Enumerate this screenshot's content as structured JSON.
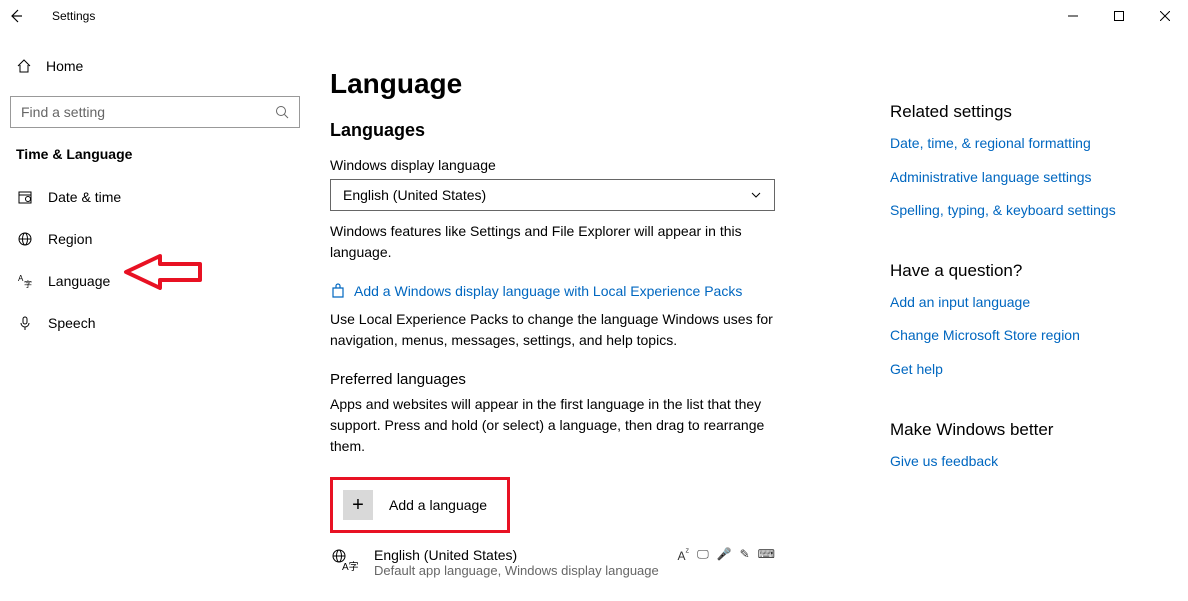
{
  "titlebar": {
    "app_title": "Settings"
  },
  "sidebar": {
    "home": "Home",
    "search_placeholder": "Find a setting",
    "category": "Time & Language",
    "items": [
      {
        "label": "Date & time"
      },
      {
        "label": "Region"
      },
      {
        "label": "Language"
      },
      {
        "label": "Speech"
      }
    ]
  },
  "main": {
    "page_title": "Language",
    "section1_title": "Languages",
    "display_lang_label": "Windows display language",
    "display_lang_value": "English (United States)",
    "display_lang_desc": "Windows features like Settings and File Explorer will appear in this language.",
    "store_link": "Add a Windows display language with Local Experience Packs",
    "store_desc": "Use Local Experience Packs to change the language Windows uses for navigation, menus, messages, settings, and help topics.",
    "preferred_title": "Preferred languages",
    "preferred_desc": "Apps and websites will appear in the first language in the list that they support. Press and hold (or select) a language, then drag to rearrange them.",
    "add_language": "Add a language",
    "lang_entry_name": "English (United States)",
    "lang_entry_sub": "Default app language, Windows display language"
  },
  "right": {
    "related_title": "Related settings",
    "related_links": [
      "Date, time, & regional formatting",
      "Administrative language settings",
      "Spelling, typing, & keyboard settings"
    ],
    "question_title": "Have a question?",
    "question_links": [
      "Add an input language",
      "Change Microsoft Store region",
      "Get help"
    ],
    "better_title": "Make Windows better",
    "better_link": "Give us feedback"
  }
}
